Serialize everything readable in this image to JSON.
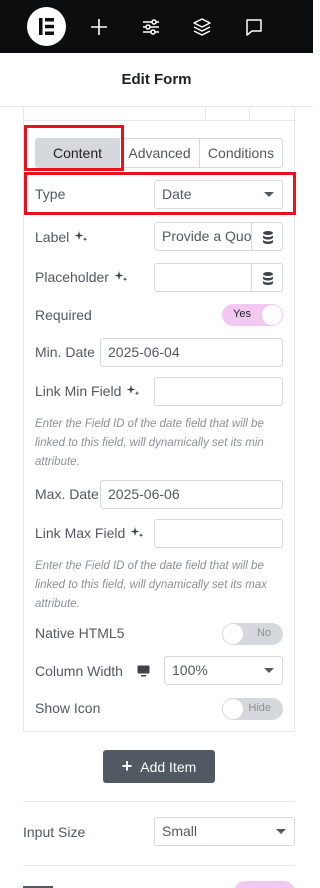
{
  "header": {
    "title": "Edit Form"
  },
  "topbar": {
    "icons": [
      "elementor-logo-icon",
      "plus-icon",
      "sliders-icon",
      "layers-icon",
      "chat-icon"
    ]
  },
  "tabs": [
    {
      "label": "Content",
      "active": true
    },
    {
      "label": "Advanced",
      "active": false
    },
    {
      "label": "Conditions",
      "active": false
    }
  ],
  "fields": {
    "type": {
      "label": "Type",
      "value": "Date"
    },
    "label": {
      "label": "Label",
      "value": "Provide a Quo"
    },
    "placeholder": {
      "label": "Placeholder",
      "value": ""
    },
    "required": {
      "label": "Required",
      "state": "Yes"
    },
    "min_date": {
      "label": "Min. Date",
      "value": "2025-06-04"
    },
    "link_min": {
      "label": "Link Min Field",
      "value": "",
      "description": "Enter the Field ID of the date field that will be linked to this field, will dynamically set its min attribute."
    },
    "max_date": {
      "label": "Max. Date",
      "value": "2025-06-06"
    },
    "link_max": {
      "label": "Link Max Field",
      "value": "",
      "description": "Enter the Field ID of the date field that will be linked to this field, will dynamically set its max attribute."
    },
    "native_html5": {
      "label": "Native HTML5",
      "state": "No"
    },
    "column_width": {
      "label": "Column Width",
      "value": "100%"
    },
    "show_icon": {
      "label": "Show Icon",
      "state": "Hide"
    }
  },
  "add_item": {
    "label": "Add Item"
  },
  "input_size": {
    "label": "Input Size",
    "value": "Small"
  },
  "colors": {
    "highlight": "#e8121c",
    "toggle_on": "#f0c8f0",
    "button": "#515962",
    "topbar": "#0c0d0e"
  }
}
